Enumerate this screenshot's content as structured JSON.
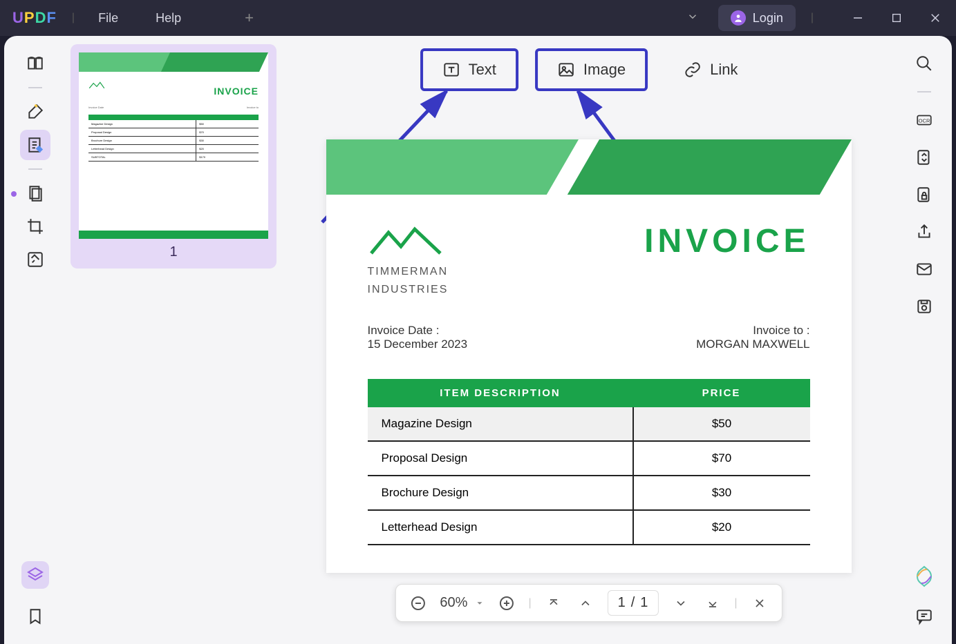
{
  "titlebar": {
    "menu": {
      "file": "File",
      "help": "Help"
    },
    "login": "Login"
  },
  "thumbnail": {
    "page_num": "1"
  },
  "edit_toolbar": {
    "text": "Text",
    "image": "Image",
    "link": "Link"
  },
  "document": {
    "company_line1": "TIMMERMAN",
    "company_line2": "INDUSTRIES",
    "title": "INVOICE",
    "date_label": "Invoice Date :",
    "date_value": "15 December 2023",
    "to_label": "Invoice to :",
    "to_value": "MORGAN MAXWELL",
    "headers": {
      "desc": "ITEM DESCRIPTION",
      "price": "PRICE"
    },
    "rows": [
      {
        "desc": "Magazine Design",
        "price": "$50"
      },
      {
        "desc": "Proposal Design",
        "price": "$70"
      },
      {
        "desc": "Brochure Design",
        "price": "$30"
      },
      {
        "desc": "Letterhead Design",
        "price": "$20"
      }
    ]
  },
  "zoom_bar": {
    "zoom": "60%",
    "page_current": "1",
    "page_sep": "/",
    "page_total": "1"
  }
}
